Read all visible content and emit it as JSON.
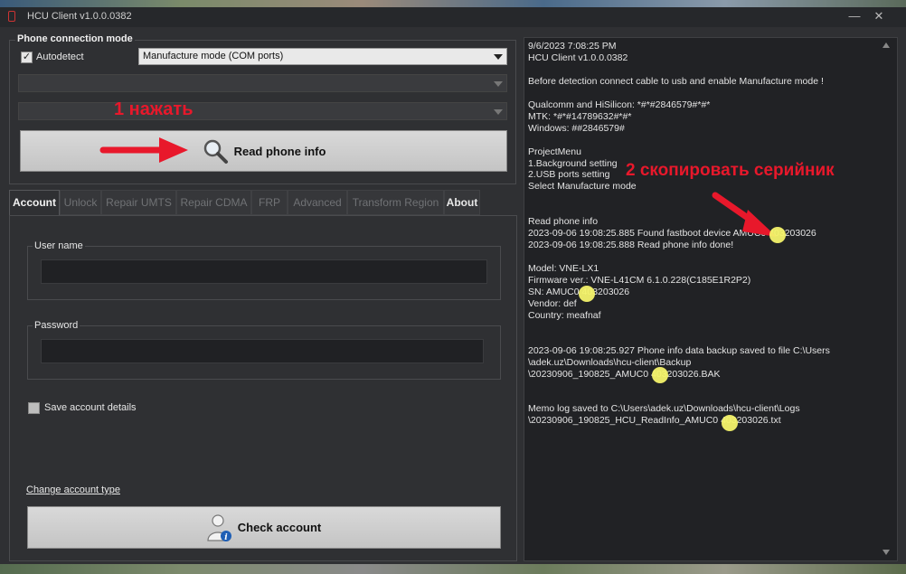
{
  "window": {
    "title": "HCU Client   v1.0.0.0382"
  },
  "connection": {
    "group_title": "Phone connection mode",
    "autodetect_label": "Autodetect",
    "autodetect_checked": true,
    "mode_value": "Manufacture mode (COM ports)",
    "read_button_label": "Read phone info"
  },
  "annotations": {
    "step1": "1 нажать",
    "step2": "2 скопировать серийник",
    "color": "#e8182b",
    "highlight_color": "#f4f36a"
  },
  "tabs": [
    {
      "label": "Account",
      "active": true
    },
    {
      "label": "Unlock"
    },
    {
      "label": "Repair UMTS"
    },
    {
      "label": "Repair CDMA"
    },
    {
      "label": "FRP"
    },
    {
      "label": "Advanced"
    },
    {
      "label": "Transform Region"
    },
    {
      "label": "About"
    }
  ],
  "account": {
    "username_label": "User name",
    "username_value": "",
    "password_label": "Password",
    "password_value": "",
    "save_label": "Save account details",
    "save_checked": false,
    "change_link": "Change account type",
    "check_button_label": "Check account"
  },
  "log": [
    "9/6/2023 7:08:25 PM",
    "HCU Client   v1.0.0.0382",
    "",
    "Before detection connect cable to usb and enable Manufacture mode !",
    "",
    "Qualcomm and HiSilicon: *#*#2846579#*#*",
    "MTK: *#*#14789632#*#*",
    "Windows: ##2846579#",
    "",
    "ProjectMenu",
    "1.Background setting",
    "2.USB ports setting",
    "Select Manufacture mode",
    "",
    "",
    "Read phone info",
    "2023-09-06 19:08:25.885 Found fastboot device AMUC0  403203026",
    "2023-09-06 19:08:25.888 Read phone info done!",
    "",
    "Model: VNE-LX1",
    "Firmware ver.: VNE-L41CM 6.1.0.228(C185E1R2P2)",
    "SN: AMUC0  403203026",
    "Vendor: def",
    "Country: meafnaf",
    "",
    "",
    "2023-09-06 19:08:25.927 Phone info data backup saved to file C:\\Users",
    "\\adek.uz\\Downloads\\hcu-client\\Backup",
    "\\20230906_190825_AMUC0  403203026.BAK",
    "",
    "",
    "Memo log saved to C:\\Users\\adek.uz\\Downloads\\hcu-client\\Logs",
    "\\20230906_190825_HCU_ReadInfo_AMUC0  403203026.txt"
  ],
  "icons": {
    "app": "hcu-app-icon",
    "search": "magnifier-icon",
    "user": "user-info-icon"
  }
}
